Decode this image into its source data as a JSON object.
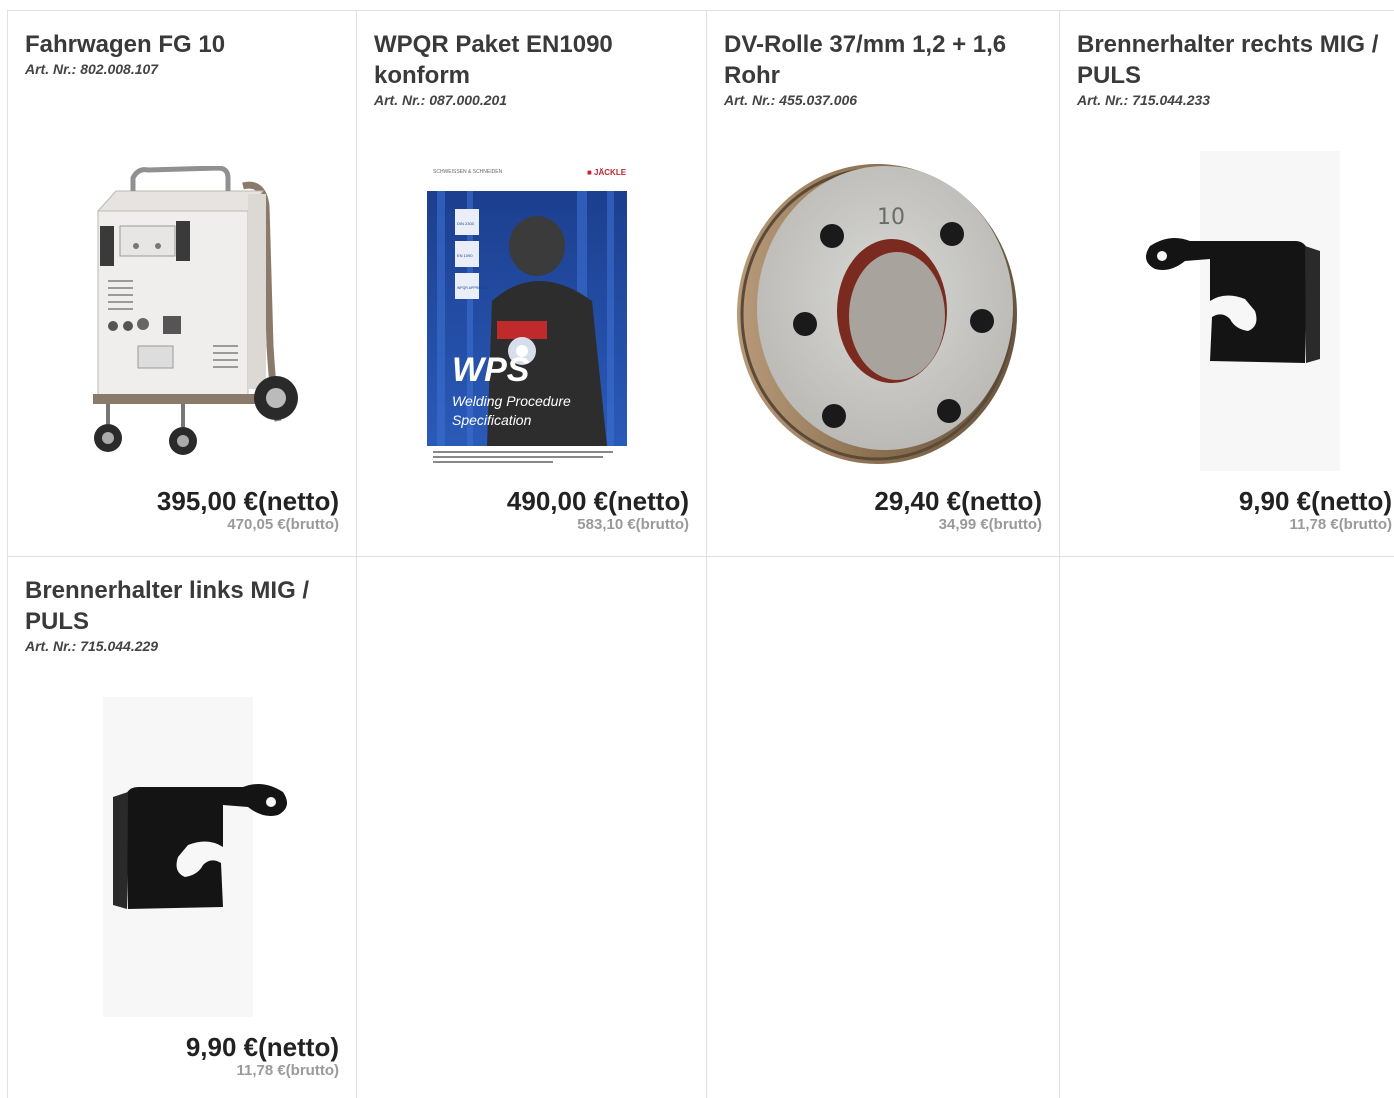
{
  "products": [
    {
      "name": "Fahrwagen FG 10",
      "art_label": "Art. Nr.:",
      "art_nr": "802.008.107",
      "price_net": "395,00 €(netto)",
      "price_gross": "470,05 €(brutto)",
      "image": "welding-cart-image"
    },
    {
      "name": "WPQR Paket EN1090 konform",
      "art_label": "Art. Nr.:",
      "art_nr": "087.000.201",
      "price_net": "490,00 €(netto)",
      "price_gross": "583,10 €(brutto)",
      "image": "wps-brochure-image",
      "brochure": {
        "brand": "■ JÄCKLE",
        "header_text": "SCHWEISSEN & SCHNEIDEN",
        "badges": [
          "DIN 2303",
          "EN 1090",
          "WPQR APPROVED"
        ],
        "big": "WPS",
        "subtitle_1": "Welding Procedure",
        "subtitle_2": "Specification"
      }
    },
    {
      "name": "DV-Rolle 37/mm 1,2 + 1,6 Rohr",
      "art_label": "Art. Nr.:",
      "art_nr": "455.037.006",
      "price_net": "29,40 €(netto)",
      "price_gross": "34,99 €(brutto)",
      "image": "drive-roll-image",
      "roll_mark": "10"
    },
    {
      "name": "Brennerhalter rechts MIG / PULS",
      "art_label": "Art. Nr.:",
      "art_nr": "715.044.233",
      "price_net": "9,90 €(netto)",
      "price_gross": "11,78 €(brutto)",
      "image": "torch-holder-right-image"
    },
    {
      "name": "Brennerhalter links MIG / PULS",
      "art_label": "Art. Nr.:",
      "art_nr": "715.044.229",
      "price_net": "9,90 €(netto)",
      "price_gross": "11,78 €(brutto)",
      "image": "torch-holder-left-image"
    }
  ],
  "colors": {
    "border": "#e0e0e0",
    "title": "#3a3a3a",
    "price_net": "#222222",
    "price_gross": "#9a9a9a"
  }
}
